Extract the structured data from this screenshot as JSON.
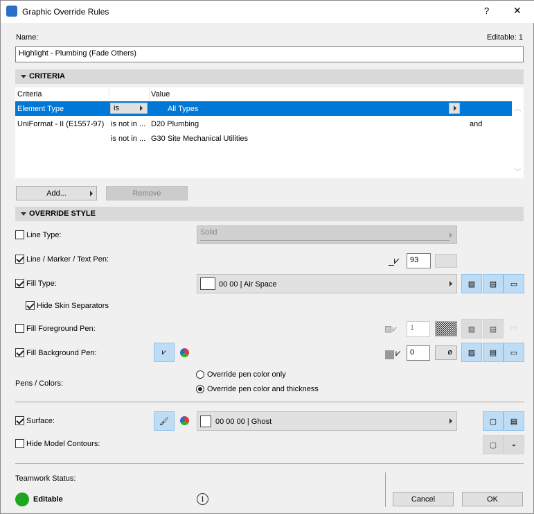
{
  "window": {
    "title": "Graphic Override Rules",
    "help": "?",
    "close": "✕"
  },
  "name": {
    "label": "Name:",
    "editable": "Editable: 1",
    "value": "Highlight - Plumbing (Fade Others)"
  },
  "criteria": {
    "section": "CRITERIA",
    "headers": [
      "Criteria",
      "",
      "Value"
    ],
    "rows": [
      {
        "criteria": "Element Type",
        "op": "is",
        "value": "All Types",
        "conj": ""
      },
      {
        "criteria": "UniFormat - II (E1557-97)",
        "op": "is not in ...",
        "value": "D20 Plumbing",
        "conj": "and"
      },
      {
        "criteria": "",
        "op": "is not in ...",
        "value": "G30 Site Mechanical Utilities",
        "conj": ""
      }
    ],
    "add": "Add...",
    "remove": "Remove"
  },
  "override": {
    "section": "OVERRIDE STYLE",
    "line_type": {
      "label": "Line Type:",
      "checked": false,
      "value": "Solid"
    },
    "line_pen": {
      "label": "Line / Marker / Text Pen:",
      "checked": true,
      "value": "93"
    },
    "fill_type": {
      "label": "Fill Type:",
      "checked": true,
      "value": "00 00 | Air Space"
    },
    "hide_skin": {
      "label": "Hide Skin Separators",
      "checked": true
    },
    "fill_fg": {
      "label": "Fill Foreground Pen:",
      "checked": false,
      "value": "1"
    },
    "fill_bg": {
      "label": "Fill Background Pen:",
      "checked": true,
      "value": "0",
      "empty": "ø"
    },
    "pens": {
      "label": "Pens / Colors:",
      "opt1": "Override pen color only",
      "opt2": "Override pen color and thickness",
      "selected": 2
    },
    "surface": {
      "label": "Surface:",
      "checked": true,
      "value": "00 00 00 | Ghost"
    },
    "hide_contours": {
      "label": "Hide Model Contours:",
      "checked": false
    }
  },
  "teamwork": {
    "label": "Teamwork Status:",
    "status": "Editable",
    "status_color": "#1fa51f"
  },
  "buttons": {
    "cancel": "Cancel",
    "ok": "OK"
  }
}
